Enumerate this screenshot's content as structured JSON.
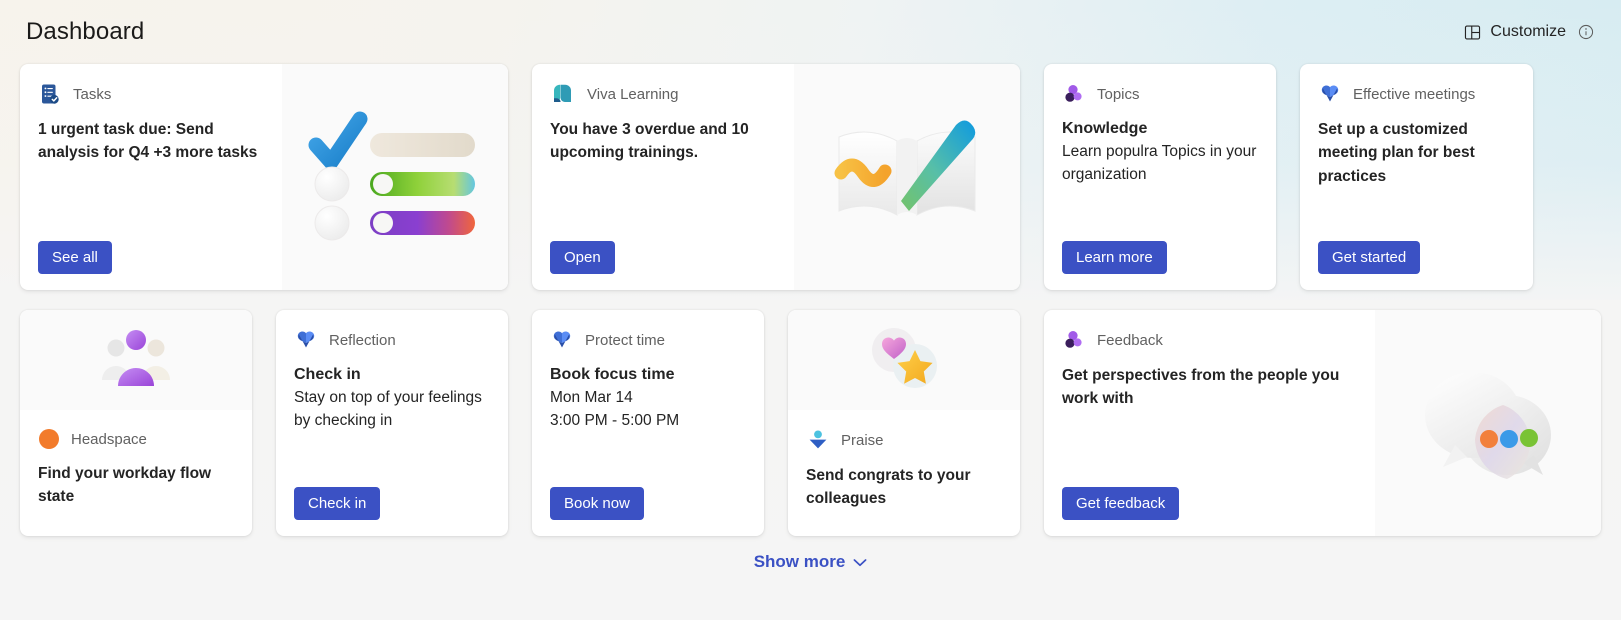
{
  "header": {
    "title": "Dashboard",
    "customize_label": "Customize",
    "customize_icon": "layout-grid-icon",
    "info_icon": "info-circle-icon"
  },
  "theme": {
    "accent": "#3b51c4",
    "page_bg": "#f5f5f5",
    "card_bg": "#ffffff",
    "art_bg": "#fafafa",
    "muted_text": "#616161",
    "primary_text": "#242424"
  },
  "cards": {
    "tasks": {
      "brand": "Tasks",
      "icon": "tasks-checklist-icon",
      "headline": "1 urgent task due: Send analysis for Q4 +3 more tasks",
      "button": "See all",
      "art": "checklist-illustration"
    },
    "viva_learning": {
      "brand": "Viva Learning",
      "icon": "viva-learning-icon",
      "headline": "You have 3 overdue and 10 upcoming trainings.",
      "button": "Open",
      "art": "book-and-pen-illustration"
    },
    "topics": {
      "brand": "Topics",
      "icon": "topics-icon",
      "headline": "Knowledge",
      "sub": "Learn populra Topics in your organization",
      "button": "Learn more"
    },
    "effective_meetings": {
      "brand": "Effective meetings",
      "icon": "viva-insights-icon",
      "headline": "Set up a customized meeting plan for best practices",
      "button": "Get started"
    },
    "headspace": {
      "brand": "Headspace",
      "icon": "headspace-dot-icon",
      "headline": "Find your workday flow state",
      "art": "people-illustration"
    },
    "reflection": {
      "brand": "Reflection",
      "icon": "viva-insights-icon",
      "headline": "Check in",
      "sub": "Stay on top of your feelings by checking in",
      "button": "Check in"
    },
    "protect_time": {
      "brand": "Protect time",
      "icon": "viva-insights-icon",
      "headline": "Book focus time",
      "date": "Mon Mar 14",
      "time": "3:00 PM - 5:00 PM",
      "button": "Book now"
    },
    "praise": {
      "brand": "Praise",
      "icon": "praise-person-icon",
      "headline": "Send congrats to your colleagues",
      "art": "heart-and-star-illustration"
    },
    "feedback": {
      "brand": "Feedback",
      "icon": "topics-icon",
      "headline": "Get perspectives from the people you work with",
      "button": "Get feedback",
      "art": "speech-bubbles-illustration"
    }
  },
  "footer": {
    "show_more_label": "Show more",
    "chevron_icon": "chevron-down-icon"
  }
}
